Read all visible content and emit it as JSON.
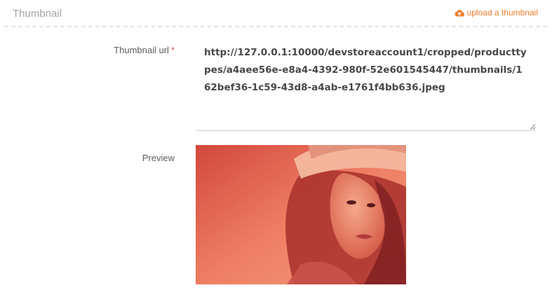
{
  "section": {
    "title": "Thumbnail",
    "upload_label": "upload a thumbnail"
  },
  "thumbnail_url": {
    "label": "Thumbnail url",
    "required_mark": "*",
    "value": "http://127.0.0.1:10000/devstoreaccount1/cropped/producttypes/a4aee56e-e8a4-4392-980f-52e601545447/thumbnails/162bef36-1c59-43d8-a4ab-e1761f4bb636.jpeg"
  },
  "preview": {
    "label": "Preview"
  },
  "colors": {
    "accent": "#ef7d2b",
    "required": "#e04b4b",
    "preview_tint": "#e9654f"
  },
  "icons": {
    "upload": "cloud-upload-icon"
  }
}
